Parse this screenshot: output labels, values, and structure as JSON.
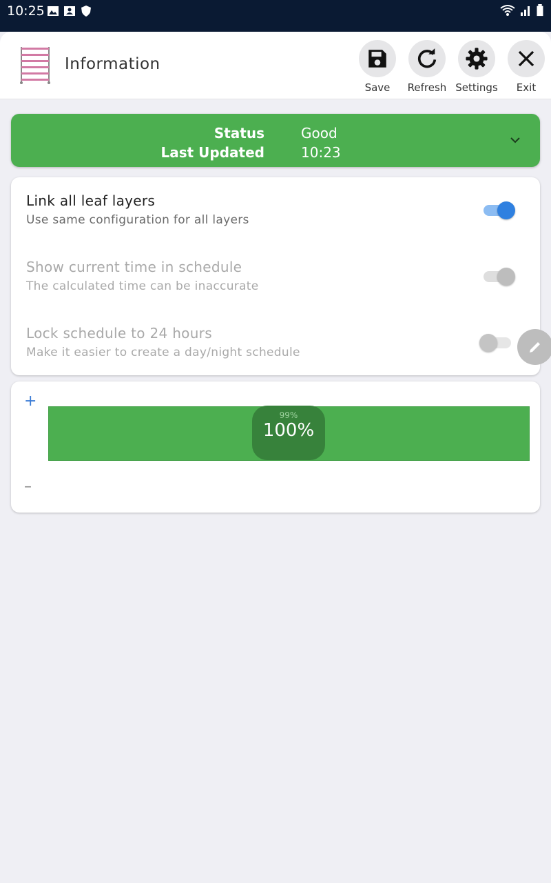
{
  "status_bar": {
    "time": "10:25"
  },
  "header": {
    "title": "Information",
    "actions": [
      {
        "label": "Save",
        "icon": "save-icon"
      },
      {
        "label": "Refresh",
        "icon": "refresh-icon"
      },
      {
        "label": "Settings",
        "icon": "gear-icon"
      },
      {
        "label": "Exit",
        "icon": "close-icon"
      }
    ]
  },
  "status_banner": {
    "status_key": "Status",
    "status_value": "Good",
    "updated_key": "Last Updated",
    "updated_value": "10:23",
    "color": "#4caf50"
  },
  "settings": [
    {
      "title": "Link all leaf layers",
      "subtitle": "Use same configuration for all layers",
      "enabled": true,
      "checked": true
    },
    {
      "title": "Show current time in schedule",
      "subtitle": "The calculated time can be inaccurate",
      "enabled": false,
      "checked": true
    },
    {
      "title": "Lock schedule to 24 hours",
      "subtitle": "Make it easier to create a day/night schedule",
      "enabled": false,
      "checked": false
    }
  ],
  "level": {
    "plus": "+",
    "minus": "–",
    "previous": "99%",
    "current": "100%",
    "fill_percent": 100,
    "color": "#4caf50"
  },
  "colors": {
    "accent": "#2f80e0",
    "status_good": "#4caf50"
  }
}
